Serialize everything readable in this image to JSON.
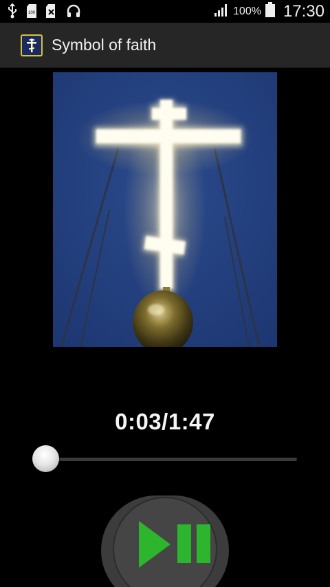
{
  "status_bar": {
    "icons": [
      "usb-icon",
      "sd-card-icon",
      "no-sim-icon",
      "headphones-icon",
      "signal-icon",
      "battery-icon"
    ],
    "battery_percent": "100%",
    "time": "17:30"
  },
  "action_bar": {
    "app_icon": "cross-icon",
    "title": "Symbol of faith"
  },
  "artwork": {
    "subject": "illuminated-orthodox-cross-on-golden-dome"
  },
  "player": {
    "time_display": "0:03/1:47",
    "progress": 0.028,
    "button_icon": "play-pause-icon"
  },
  "colors": {
    "action_bar": "#262626",
    "button_green": "#2db52d",
    "sky": "#23417f"
  }
}
